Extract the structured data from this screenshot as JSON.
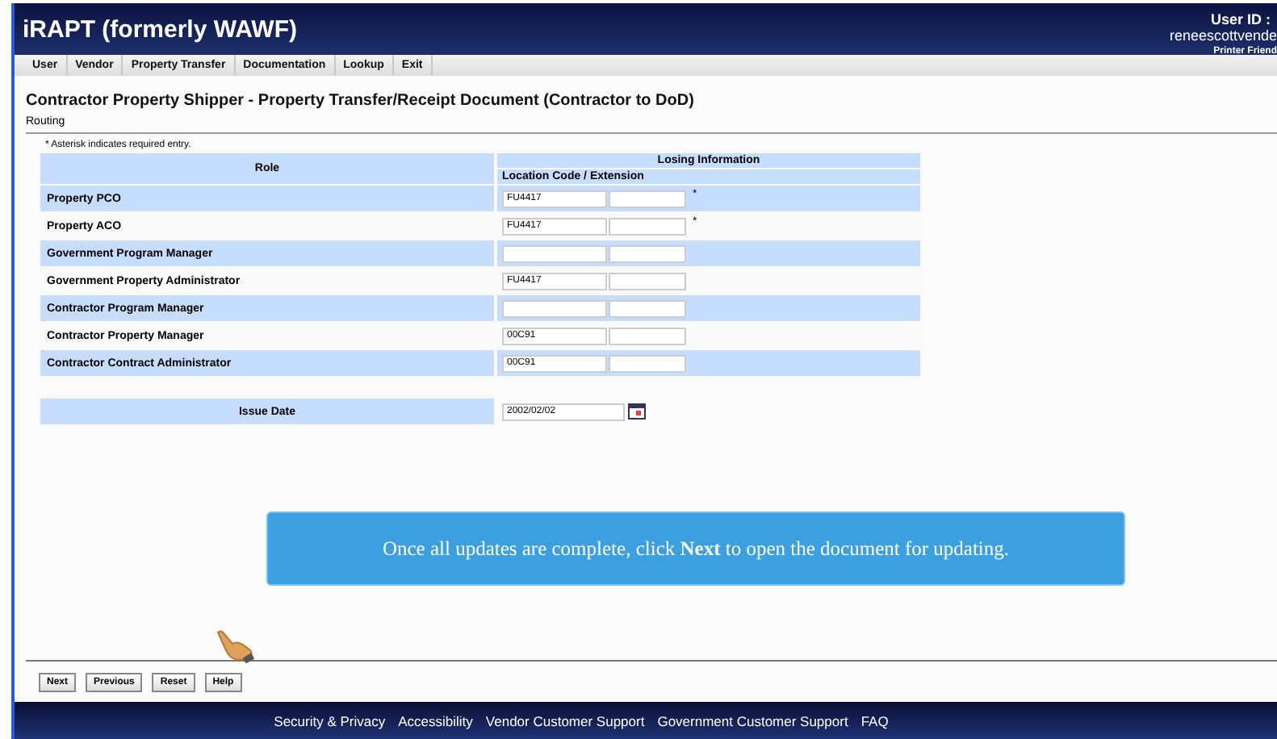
{
  "header": {
    "app_title": "iRAPT (formerly WAWF)",
    "user_id_label": "User ID :",
    "user_id": "reneescottvende",
    "printer_link": "Printer Friend"
  },
  "menu": [
    "User",
    "Vendor",
    "Property Transfer",
    "Documentation",
    "Lookup",
    "Exit"
  ],
  "page_title": "Contractor Property Shipper - Property Transfer/Receipt Document (Contractor to DoD)",
  "section": "Routing",
  "note": "* Asterisk indicates required entry.",
  "table": {
    "columns": {
      "role": "Role",
      "group": "Losing Information",
      "sub": "Location Code / Extension"
    },
    "rows": [
      {
        "role": "Property PCO",
        "code": "FU4417",
        "marker": "*"
      },
      {
        "role": "Property ACO",
        "code": "FU4417",
        "marker": "*"
      },
      {
        "role": "Government Program Manager"
      },
      {
        "role": "Government Property Administrator",
        "code": "FU4417"
      },
      {
        "role": "Contractor Program Manager"
      },
      {
        "role": "Contractor Property Manager",
        "code": "00C91"
      },
      {
        "role": "Contractor Contract Administrator",
        "code": "00C91"
      }
    ]
  },
  "issue_date": {
    "label": "Issue Date",
    "value": "2002/02/02"
  },
  "callout": "Once all updates are complete, click **Next** to open the document for updating.",
  "buttons": [
    "Next",
    "Previous",
    "Reset",
    "Help"
  ],
  "footer": [
    "Security & Privacy",
    "Accessibility",
    "Vendor Customer Support",
    "Government Customer Support",
    "FAQ"
  ]
}
